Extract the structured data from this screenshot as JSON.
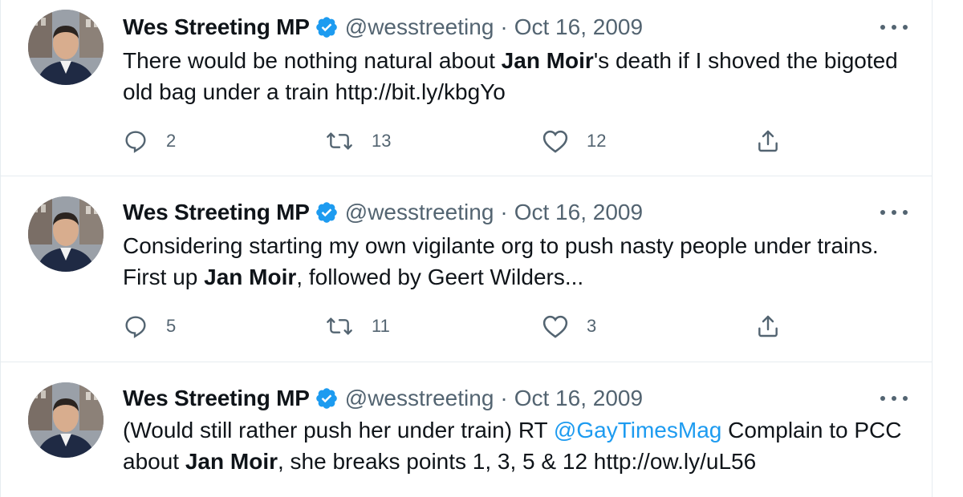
{
  "tweets": [
    {
      "author": {
        "name": "Wes Streeting MP",
        "handle": "@wesstreeting",
        "separator": "·",
        "date": "Oct 16, 2009"
      },
      "text": {
        "p1": "There would be nothing natural about ",
        "bold1": "Jan Moir",
        "p2": "'s death if I shoved the bigoted old bag under a train ",
        "link": "http://bit.ly/kbgYo"
      },
      "stats": {
        "replies": "2",
        "retweets": "13",
        "likes": "12"
      }
    },
    {
      "author": {
        "name": "Wes Streeting MP",
        "handle": "@wesstreeting",
        "separator": "·",
        "date": "Oct 16, 2009"
      },
      "text": {
        "p1": "Considering starting my own vigilante org to push nasty people under trains. First up ",
        "bold1": "Jan Moir",
        "p2": ", followed by Geert Wilders..."
      },
      "stats": {
        "replies": "5",
        "retweets": "11",
        "likes": "3"
      }
    },
    {
      "author": {
        "name": "Wes Streeting MP",
        "handle": "@wesstreeting",
        "separator": "·",
        "date": "Oct 16, 2009"
      },
      "text": {
        "p1": "(Would still rather push her under train) RT ",
        "mention": "@GayTimesMag",
        "p2": " Complain to PCC about ",
        "bold1": "Jan Moir",
        "p3": ", she breaks points 1, 3, 5 & 12 ",
        "link": "http://ow.ly/uL56"
      }
    }
  ],
  "icons": {
    "verified": "verified-badge-icon",
    "more": "more-options-icon",
    "reply": "reply-icon",
    "retweet": "retweet-icon",
    "like": "heart-icon",
    "share": "share-icon"
  },
  "colors": {
    "verified": "#1d9bf0",
    "mention": "#1d9bf0",
    "secondary_text": "#536471",
    "primary_text": "#0f1419",
    "divider": "#e6ecf0"
  }
}
